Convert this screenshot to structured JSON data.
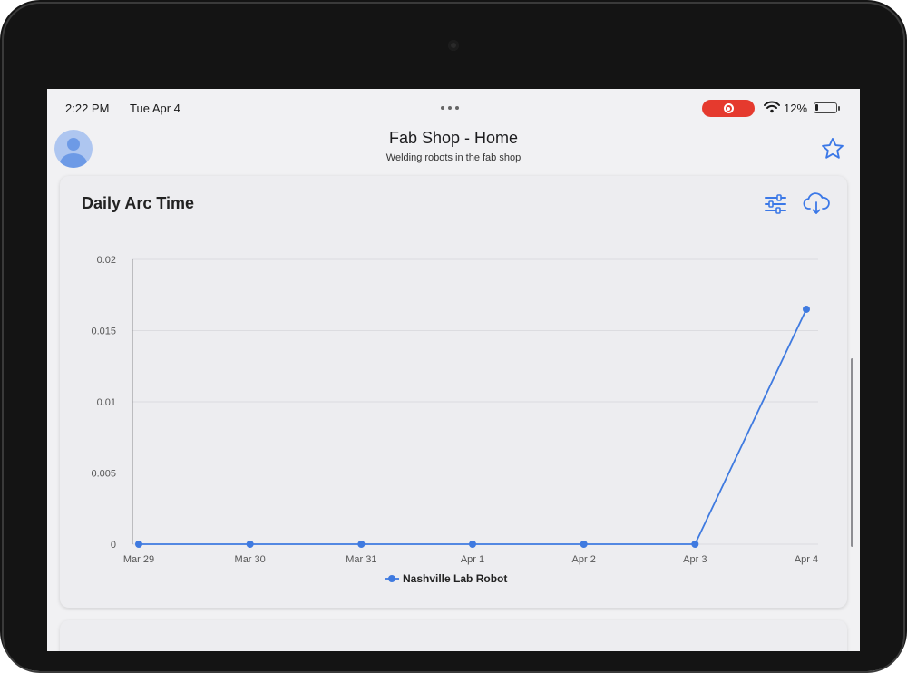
{
  "status_bar": {
    "time": "2:22 PM",
    "date": "Tue Apr 4",
    "battery": "12%",
    "icons": [
      "multitask-dots-icon",
      "screen-record-icon",
      "wifi-icon",
      "battery-icon"
    ]
  },
  "nav": {
    "title": "Fab Shop - Home",
    "subtitle": "Welding robots in the fab shop",
    "icons": [
      "avatar-icon",
      "star-icon"
    ]
  },
  "card": {
    "title": "Daily Arc Time",
    "icons": [
      "filter-sliders-icon",
      "cloud-download-icon"
    ]
  },
  "colors": {
    "accent": "#3b78e7",
    "series": "#3f7ae0",
    "record": "#e53a2e",
    "grid": "#dcdce0"
  },
  "chart_data": {
    "type": "line",
    "title": "Daily Arc Time",
    "xlabel": "",
    "ylabel": "",
    "categories": [
      "Mar 29",
      "Mar 30",
      "Mar 31",
      "Apr 1",
      "Apr 2",
      "Apr 3",
      "Apr 4"
    ],
    "y_ticks": [
      "0",
      "0.005",
      "0.01",
      "0.015",
      "0.02"
    ],
    "ylim": [
      0,
      0.02
    ],
    "grid": true,
    "legend_position": "bottom",
    "series": [
      {
        "name": "Nashville Lab Robot",
        "values": [
          0,
          0,
          0,
          0,
          0,
          0,
          0.0165
        ]
      }
    ]
  }
}
